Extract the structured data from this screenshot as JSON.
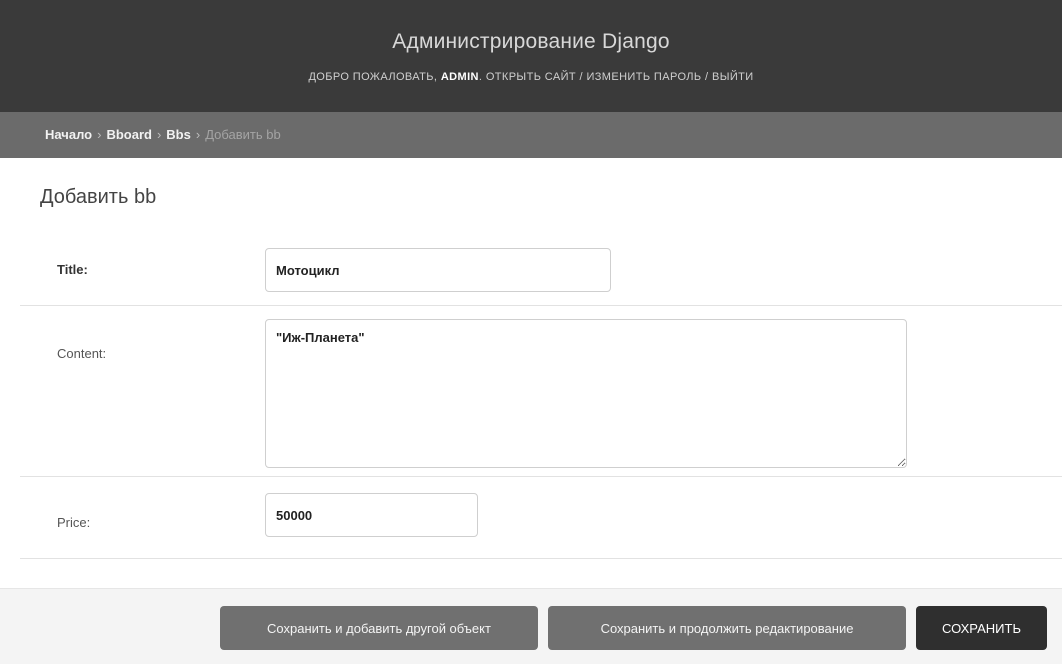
{
  "header": {
    "site_title": "Администрирование Django",
    "welcome_text": "Добро пожаловать,",
    "username": "admin",
    "view_site": "Открыть сайт",
    "separator": "/",
    "change_password": "Изменить пароль",
    "logout": "Выйти"
  },
  "breadcrumbs": {
    "home": "Начало",
    "app": "Bboard",
    "model": "Bbs",
    "current": "Добавить bb",
    "separator": "›"
  },
  "page": {
    "title": "Добавить bb"
  },
  "form": {
    "title": {
      "label": "Title:",
      "value": "Мотоцикл"
    },
    "content": {
      "label": "Content:",
      "value": "\"Иж-Планета\""
    },
    "price": {
      "label": "Price:",
      "value": "50000"
    }
  },
  "buttons": {
    "save_add_another": "Сохранить и добавить другой объект",
    "save_continue": "Сохранить и продолжить редактирование",
    "save": "Сохранить"
  },
  "colors": {
    "header_bg": "#3a3a3a",
    "breadcrumbs_bg": "#6b6b6b",
    "button_bg": "#707070",
    "primary_button_bg": "#2f2f2f"
  }
}
